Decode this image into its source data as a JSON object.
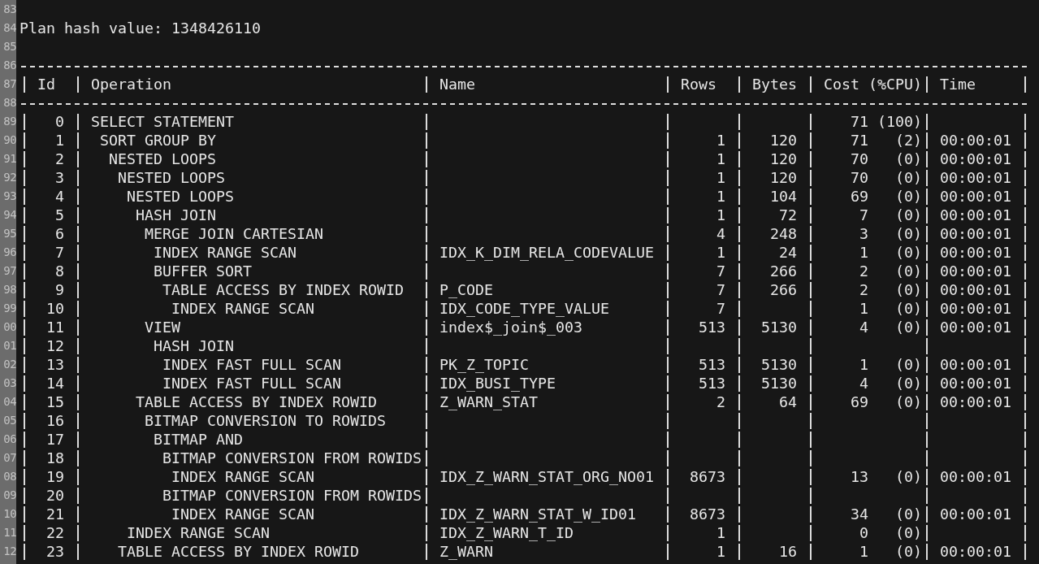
{
  "editor": {
    "line_numbers": [
      "83",
      "84",
      "85",
      "86",
      "87",
      "88",
      "89",
      "90",
      "91",
      "92",
      "93",
      "94",
      "95",
      "96",
      "97",
      "98",
      "99",
      "00",
      "01",
      "02",
      "03",
      "04",
      "05",
      "06",
      "07",
      "08",
      "09",
      "10",
      "11",
      "12"
    ]
  },
  "plan_hash": "Plan hash value: 1348426110",
  "plan_table": {
    "columns": [
      "Id",
      "Operation",
      "Name",
      "Rows",
      "Bytes",
      "Cost (%CPU)",
      "Time"
    ],
    "rows": [
      {
        "id": "0",
        "operation": "SELECT STATEMENT",
        "cost": "71",
        "cpu": "(100)",
        "children": [
          {
            "id": "1",
            "operation": "SORT GROUP BY",
            "rows": "1",
            "bytes": "120",
            "cost": "71",
            "cpu": "(2)",
            "time": "00:00:01",
            "children": [
              {
                "id": "2",
                "operation": "NESTED LOOPS",
                "rows": "1",
                "bytes": "120",
                "cost": "70",
                "cpu": "(0)",
                "time": "00:00:01",
                "children": [
                  {
                    "id": "3",
                    "operation": "NESTED LOOPS",
                    "rows": "1",
                    "bytes": "120",
                    "cost": "70",
                    "cpu": "(0)",
                    "time": "00:00:01",
                    "children": [
                      {
                        "id": "4",
                        "operation": "NESTED LOOPS",
                        "rows": "1",
                        "bytes": "104",
                        "cost": "69",
                        "cpu": "(0)",
                        "time": "00:00:01",
                        "children": [
                          {
                            "id": "5",
                            "operation": "HASH JOIN",
                            "rows": "1",
                            "bytes": "72",
                            "cost": "7",
                            "cpu": "(0)",
                            "time": "00:00:01",
                            "children": [
                              {
                                "id": "6",
                                "operation": "MERGE JOIN CARTESIAN",
                                "rows": "4",
                                "bytes": "248",
                                "cost": "3",
                                "cpu": "(0)",
                                "time": "00:00:01",
                                "children": [
                                  {
                                    "id": "7",
                                    "operation": "INDEX RANGE SCAN",
                                    "name": "IDX_K_DIM_RELA_CODEVALUE",
                                    "rows": "1",
                                    "bytes": "24",
                                    "cost": "1",
                                    "cpu": "(0)",
                                    "time": "00:00:01"
                                  },
                                  {
                                    "id": "8",
                                    "operation": "BUFFER SORT",
                                    "rows": "7",
                                    "bytes": "266",
                                    "cost": "2",
                                    "cpu": "(0)",
                                    "time": "00:00:01",
                                    "children": [
                                      {
                                        "id": "9",
                                        "operation": "TABLE ACCESS BY INDEX ROWID",
                                        "name": "P_CODE",
                                        "rows": "7",
                                        "bytes": "266",
                                        "cost": "2",
                                        "cpu": "(0)",
                                        "time": "00:00:01",
                                        "children": [
                                          {
                                            "id": "10",
                                            "operation": "INDEX RANGE SCAN",
                                            "name": "IDX_CODE_TYPE_VALUE",
                                            "rows": "7",
                                            "cost": "1",
                                            "cpu": "(0)",
                                            "time": "00:00:01"
                                          }
                                        ]
                                      }
                                    ]
                                  }
                                ]
                              },
                              {
                                "id": "11",
                                "operation": "VIEW",
                                "name": "index$_join$_003",
                                "rows": "513",
                                "bytes": "5130",
                                "cost": "4",
                                "cpu": "(0)",
                                "time": "00:00:01",
                                "children": [
                                  {
                                    "id": "12",
                                    "operation": "HASH JOIN",
                                    "children": [
                                      {
                                        "id": "13",
                                        "operation": "INDEX FAST FULL SCAN",
                                        "name": "PK_Z_TOPIC",
                                        "rows": "513",
                                        "bytes": "5130",
                                        "cost": "1",
                                        "cpu": "(0)",
                                        "time": "00:00:01"
                                      },
                                      {
                                        "id": "14",
                                        "operation": "INDEX FAST FULL SCAN",
                                        "name": "IDX_BUSI_TYPE",
                                        "rows": "513",
                                        "bytes": "5130",
                                        "cost": "4",
                                        "cpu": "(0)",
                                        "time": "00:00:01"
                                      }
                                    ]
                                  }
                                ]
                              }
                            ]
                          },
                          {
                            "id": "15",
                            "operation": "TABLE ACCESS BY INDEX ROWID",
                            "name": "Z_WARN_STAT",
                            "rows": "2",
                            "bytes": "64",
                            "cost": "69",
                            "cpu": "(0)",
                            "time": "00:00:01",
                            "children": [
                              {
                                "id": "16",
                                "operation": "BITMAP CONVERSION TO ROWIDS",
                                "children": [
                                  {
                                    "id": "17",
                                    "operation": "BITMAP AND",
                                    "children": [
                                      {
                                        "id": "18",
                                        "operation": "BITMAP CONVERSION FROM ROWIDS",
                                        "children": [
                                          {
                                            "id": "19",
                                            "operation": "INDEX RANGE SCAN",
                                            "name": "IDX_Z_WARN_STAT_ORG_NO01",
                                            "rows": "8673",
                                            "cost": "13",
                                            "cpu": "(0)",
                                            "time": "00:00:01"
                                          }
                                        ]
                                      },
                                      {
                                        "id": "20",
                                        "operation": "BITMAP CONVERSION FROM ROWIDS",
                                        "children": [
                                          {
                                            "id": "21",
                                            "operation": "INDEX RANGE SCAN",
                                            "name": "IDX_Z_WARN_STAT_W_ID01",
                                            "rows": "8673",
                                            "cost": "34",
                                            "cpu": "(0)",
                                            "time": "00:00:01"
                                          }
                                        ]
                                      }
                                    ]
                                  }
                                ]
                              }
                            ]
                          }
                        ]
                      },
                      {
                        "id": "22",
                        "operation": "INDEX RANGE SCAN",
                        "name": "IDX_Z_WARN_T_ID",
                        "rows": "1",
                        "cost": "0",
                        "cpu": "(0)"
                      }
                    ]
                  },
                  {
                    "id": "23",
                    "operation": "TABLE ACCESS BY INDEX ROWID",
                    "name": "Z_WARN",
                    "rows": "1",
                    "bytes": "16",
                    "cost": "1",
                    "cpu": "(0)",
                    "time": "00:00:01"
                  }
                ]
              }
            ]
          }
        ]
      }
    ]
  }
}
